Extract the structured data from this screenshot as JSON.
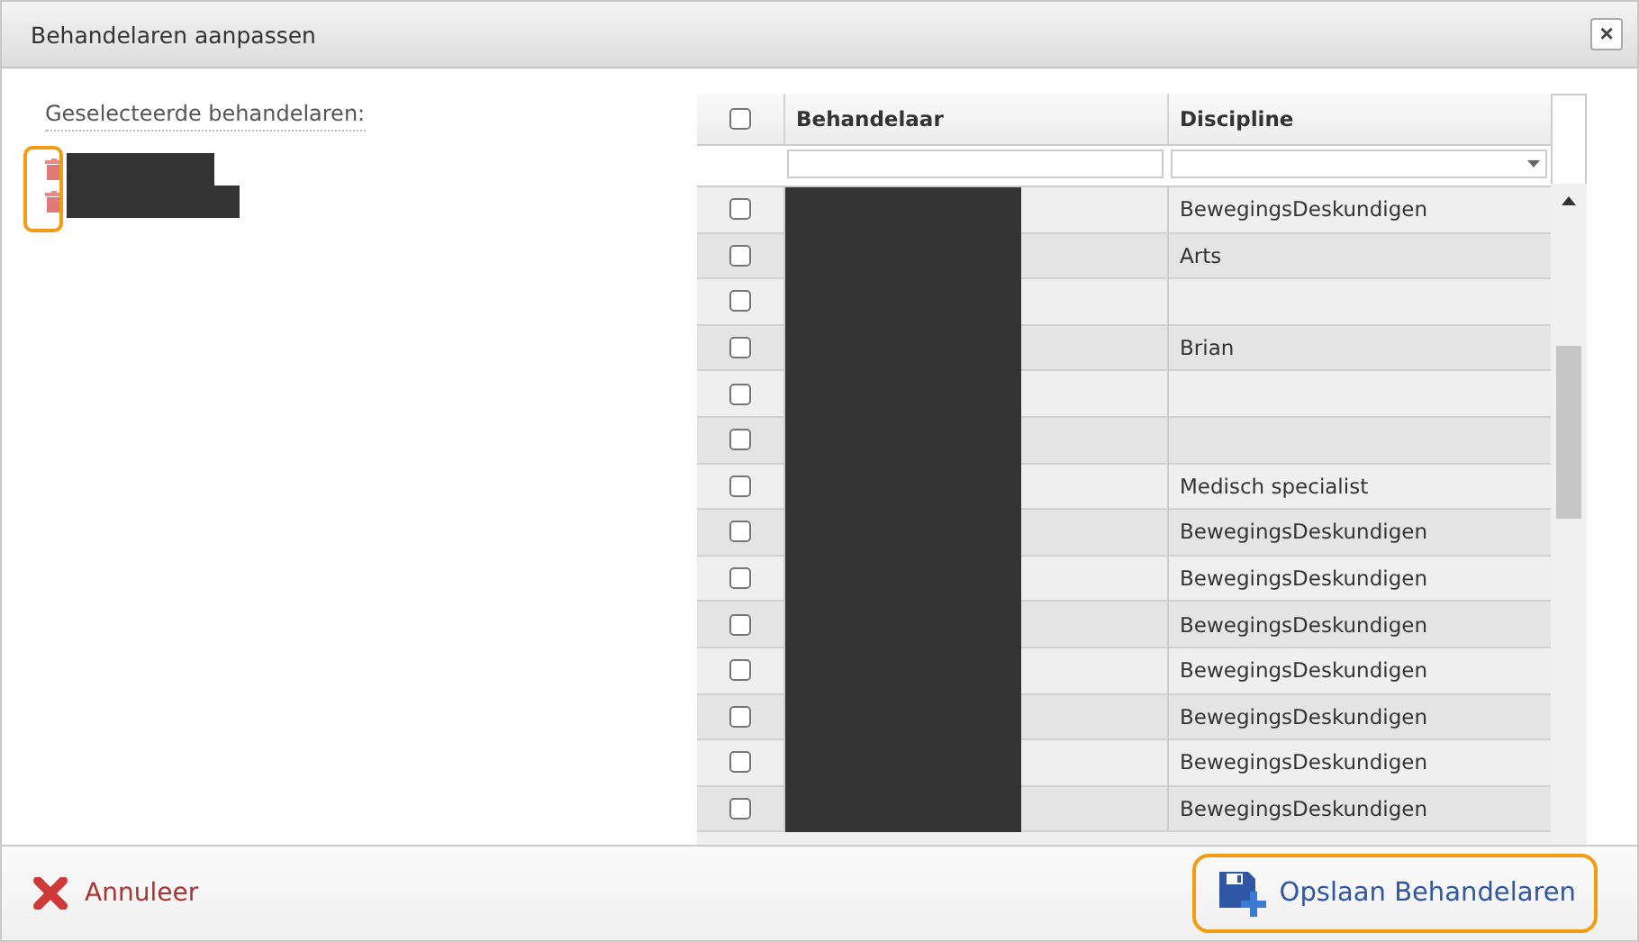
{
  "dialog": {
    "title": "Behandelaren aanpassen",
    "close_label": "×"
  },
  "selected_panel": {
    "label": "Geselecteerde behandelaren:",
    "items": [
      {
        "kind": "redacted"
      },
      {
        "kind": "redacted"
      }
    ]
  },
  "table": {
    "select_all": {
      "checked": false
    },
    "columns": [
      "Behandelaar",
      "Discipline"
    ],
    "filters": [
      {
        "kind": "text"
      },
      {
        "kind": "dropdown"
      }
    ],
    "rows": [
      {
        "checked": false,
        "discipline": "BewegingsDeskundigen"
      },
      {
        "checked": false,
        "discipline": "Arts"
      },
      {
        "checked": false,
        "discipline": ""
      },
      {
        "checked": false,
        "discipline": "Brian"
      },
      {
        "checked": false,
        "discipline": ""
      },
      {
        "checked": false,
        "discipline": ""
      },
      {
        "checked": false,
        "discipline": "Medisch specialist"
      },
      {
        "checked": false,
        "discipline": "BewegingsDeskundigen"
      },
      {
        "checked": false,
        "discipline": "BewegingsDeskundigen"
      },
      {
        "checked": false,
        "discipline": "BewegingsDeskundigen"
      },
      {
        "checked": false,
        "discipline": "BewegingsDeskundigen"
      },
      {
        "checked": false,
        "discipline": "BewegingsDeskundigen"
      },
      {
        "checked": false,
        "discipline": "BewegingsDeskundigen"
      },
      {
        "checked": false,
        "discipline": "BewegingsDeskundigen"
      }
    ]
  },
  "footer": {
    "cancel": "Annuleer",
    "save": "Opslaan Behandelaren"
  }
}
